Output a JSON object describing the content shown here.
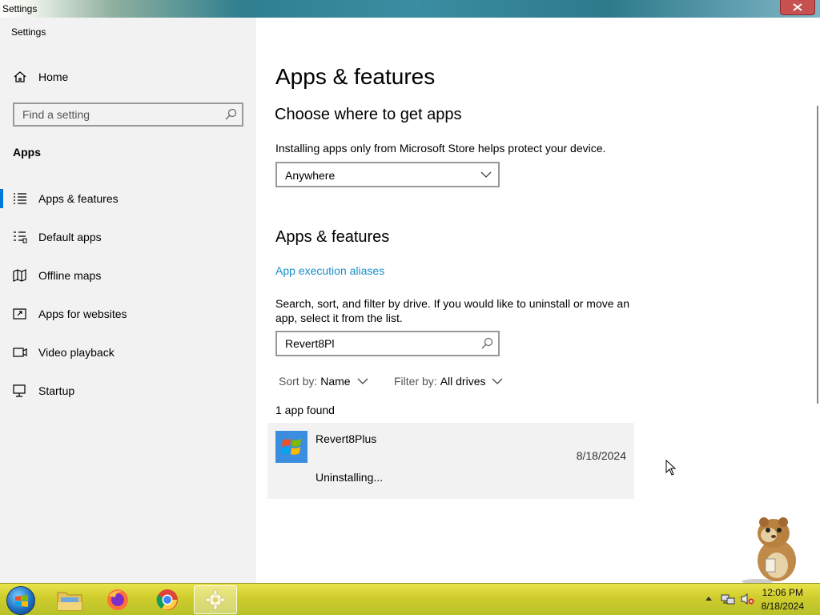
{
  "window": {
    "title": "Settings"
  },
  "sidebar": {
    "app_label": "Settings",
    "home_label": "Home",
    "search_placeholder": "Find a setting",
    "section_title": "Apps",
    "items": [
      {
        "label": "Apps & features",
        "icon": "apps-features-icon",
        "active": true
      },
      {
        "label": "Default apps",
        "icon": "default-apps-icon"
      },
      {
        "label": "Offline maps",
        "icon": "offline-maps-icon"
      },
      {
        "label": "Apps for websites",
        "icon": "apps-for-websites-icon"
      },
      {
        "label": "Video playback",
        "icon": "video-playback-icon"
      },
      {
        "label": "Startup",
        "icon": "startup-icon"
      }
    ]
  },
  "main": {
    "title": "Apps & features",
    "choose_heading": "Choose where to get apps",
    "choose_desc": "Installing apps only from Microsoft Store helps protect your device.",
    "source_selected": "Anywhere",
    "features_heading": "Apps & features",
    "aliases_link": "App execution aliases",
    "search_desc": "Search, sort, and filter by drive. If you would like to uninstall or move an app, select it from the list.",
    "search_value": "Revert8Pl",
    "sort_label": "Sort by:",
    "sort_value": "Name",
    "filter_label": "Filter by:",
    "filter_value": "All drives",
    "count_text": "1 app found",
    "apps": [
      {
        "name": "Revert8Plus",
        "date": "8/18/2024",
        "status": "Uninstalling..."
      }
    ]
  },
  "taskbar": {
    "items": [
      "file-explorer-icon",
      "firefox-icon",
      "chrome-icon",
      "settings-icon"
    ],
    "time": "12:06 PM",
    "date": "8/18/2024"
  },
  "colors": {
    "accent": "#0078d7",
    "link": "#1a8fc9",
    "close": "#c75050",
    "taskbar": "#cfcd2c"
  }
}
